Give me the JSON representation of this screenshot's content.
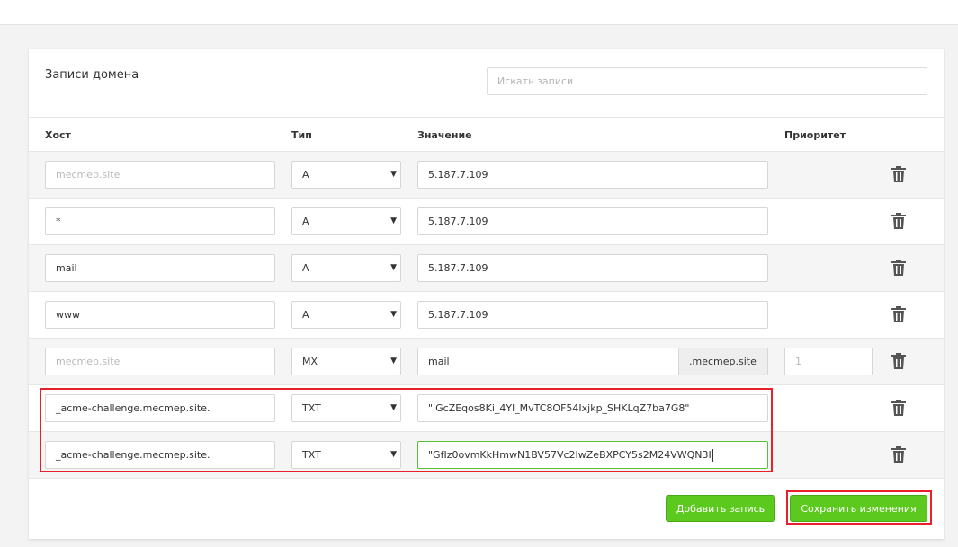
{
  "card": {
    "title": "Записи домена",
    "search_placeholder": "Искать записи"
  },
  "columns": {
    "host": "Хост",
    "type": "Тип",
    "value": "Значение",
    "priority": "Приоритет"
  },
  "records": [
    {
      "host": "",
      "host_placeholder": "mecmep.site",
      "type": "A",
      "value": "5.187.7.109"
    },
    {
      "host": "*",
      "type": "A",
      "value": "5.187.7.109"
    },
    {
      "host": "mail",
      "type": "A",
      "value": "5.187.7.109"
    },
    {
      "host": "www",
      "type": "A",
      "value": "5.187.7.109"
    },
    {
      "host": "",
      "host_placeholder": "mecmep.site",
      "type": "MX",
      "value": "mail",
      "value_suffix": ".mecmep.site",
      "priority": "",
      "priority_placeholder": "1"
    },
    {
      "host": "_acme-challenge.mecmep.site.",
      "type": "TXT",
      "value": "\"lGcZEqos8Ki_4Yl_MvTC8OF54Ixjkp_SHKLqZ7ba7G8\""
    },
    {
      "host": "_acme-challenge.mecmep.site.",
      "type": "TXT",
      "value": "\"GfIz0ovmKkHmwN1BV57Vc2IwZeBXPCY5s2M24VWQN3I"
    }
  ],
  "buttons": {
    "add": "Добавить запись",
    "save": "Сохранить изменения"
  },
  "colors": {
    "accent_green": "#5cc91f",
    "highlight_red": "#e8202a"
  },
  "icons": {
    "delete": "trash-icon",
    "select": "caret-down-icon"
  }
}
